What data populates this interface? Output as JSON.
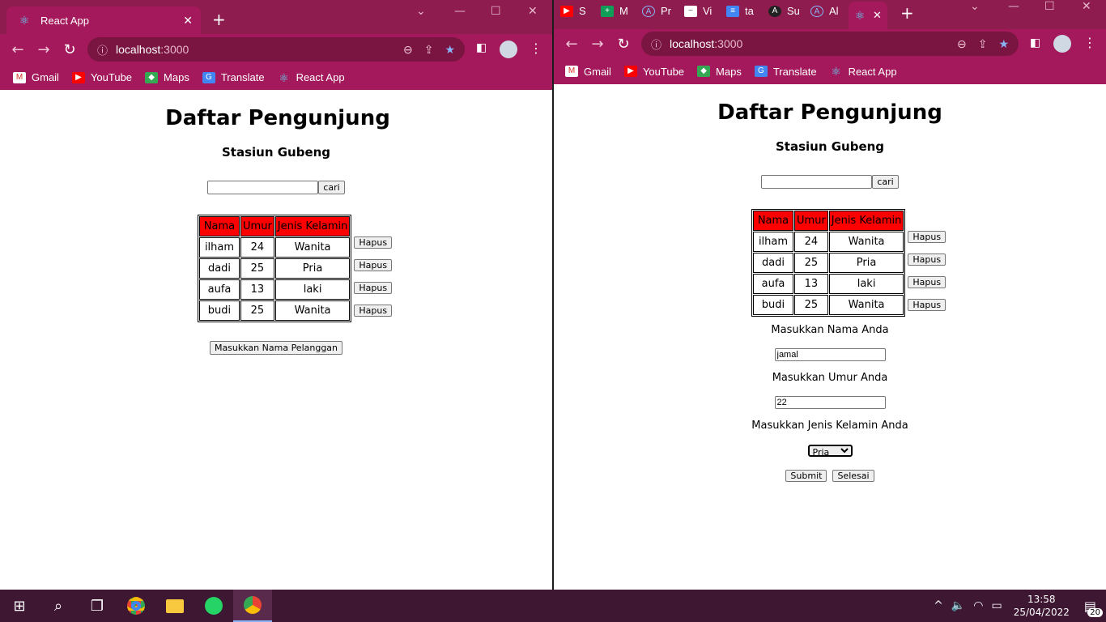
{
  "left_window": {
    "tab_title": "React App",
    "url_host": "localhost",
    "url_port": ":3000",
    "bookmarks": [
      "Gmail",
      "YouTube",
      "Maps",
      "Translate",
      "React App"
    ],
    "page": {
      "title": "Daftar Pengunjung",
      "subtitle": "Stasiun Gubeng",
      "search_button": "cari",
      "table_headers": [
        "Nama",
        "Umur",
        "Jenis Kelamin"
      ],
      "rows": [
        {
          "nama": "ilham",
          "umur": "24",
          "jk": "Wanita"
        },
        {
          "nama": "dadi",
          "umur": "25",
          "jk": "Pria"
        },
        {
          "nama": "aufa",
          "umur": "13",
          "jk": "laki"
        },
        {
          "nama": "budi",
          "umur": "25",
          "jk": "Wanita"
        }
      ],
      "delete_button": "Hapus",
      "add_button": "Masukkan Nama Pelanggan"
    }
  },
  "right_window": {
    "tabs": [
      "S",
      "M",
      "Pr",
      "Vi",
      "ta",
      "Su",
      "Al"
    ],
    "url_host": "localhost",
    "url_port": ":3000",
    "bookmarks": [
      "Gmail",
      "YouTube",
      "Maps",
      "Translate",
      "React App"
    ],
    "page": {
      "title": "Daftar Pengunjung",
      "subtitle": "Stasiun Gubeng",
      "search_button": "cari",
      "table_headers": [
        "Nama",
        "Umur",
        "Jenis Kelamin"
      ],
      "rows": [
        {
          "nama": "ilham",
          "umur": "24",
          "jk": "Wanita"
        },
        {
          "nama": "dadi",
          "umur": "25",
          "jk": "Pria"
        },
        {
          "nama": "aufa",
          "umur": "13",
          "jk": "laki"
        },
        {
          "nama": "budi",
          "umur": "25",
          "jk": "Wanita"
        }
      ],
      "delete_button": "Hapus",
      "name_label": "Masukkan Nama Anda",
      "name_value": "jamal",
      "age_label": "Masukkan Umur Anda",
      "age_value": "22",
      "gender_label": "Masukkan Jenis Kelamin Anda",
      "gender_value": "Pria",
      "submit_button": "Submit",
      "done_button": "Selesai"
    }
  },
  "taskbar": {
    "time": "13:58",
    "date": "25/04/2022",
    "notification_count": "20"
  }
}
